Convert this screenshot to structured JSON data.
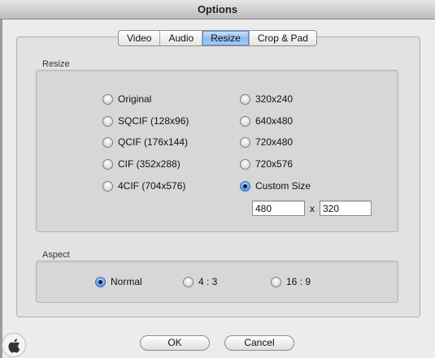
{
  "window": {
    "title": "Options"
  },
  "tabs": [
    {
      "label": "Video",
      "active": false
    },
    {
      "label": "Audio",
      "active": false
    },
    {
      "label": "Resize",
      "active": true
    },
    {
      "label": "Crop & Pad",
      "active": false
    }
  ],
  "resize": {
    "label": "Resize",
    "options_left": [
      "Original",
      "SQCIF (128x96)",
      "QCIF (176x144)",
      "CIF (352x288)",
      "4CIF (704x576)"
    ],
    "options_right": [
      "320x240",
      "640x480",
      "720x480",
      "720x576",
      "Custom Size"
    ],
    "selected": "Custom Size",
    "custom_width": "480",
    "custom_height": "320",
    "separator": "x"
  },
  "aspect": {
    "label": "Aspect",
    "options": [
      "Normal",
      "4 : 3",
      "16 : 9"
    ],
    "selected": "Normal"
  },
  "buttons": {
    "ok": "OK",
    "cancel": "Cancel"
  },
  "icons": {
    "watermark": "apple-logo-icon"
  },
  "colors": {
    "selection_blue": "#5a95e3",
    "tab_active": "#8fbbf0"
  }
}
